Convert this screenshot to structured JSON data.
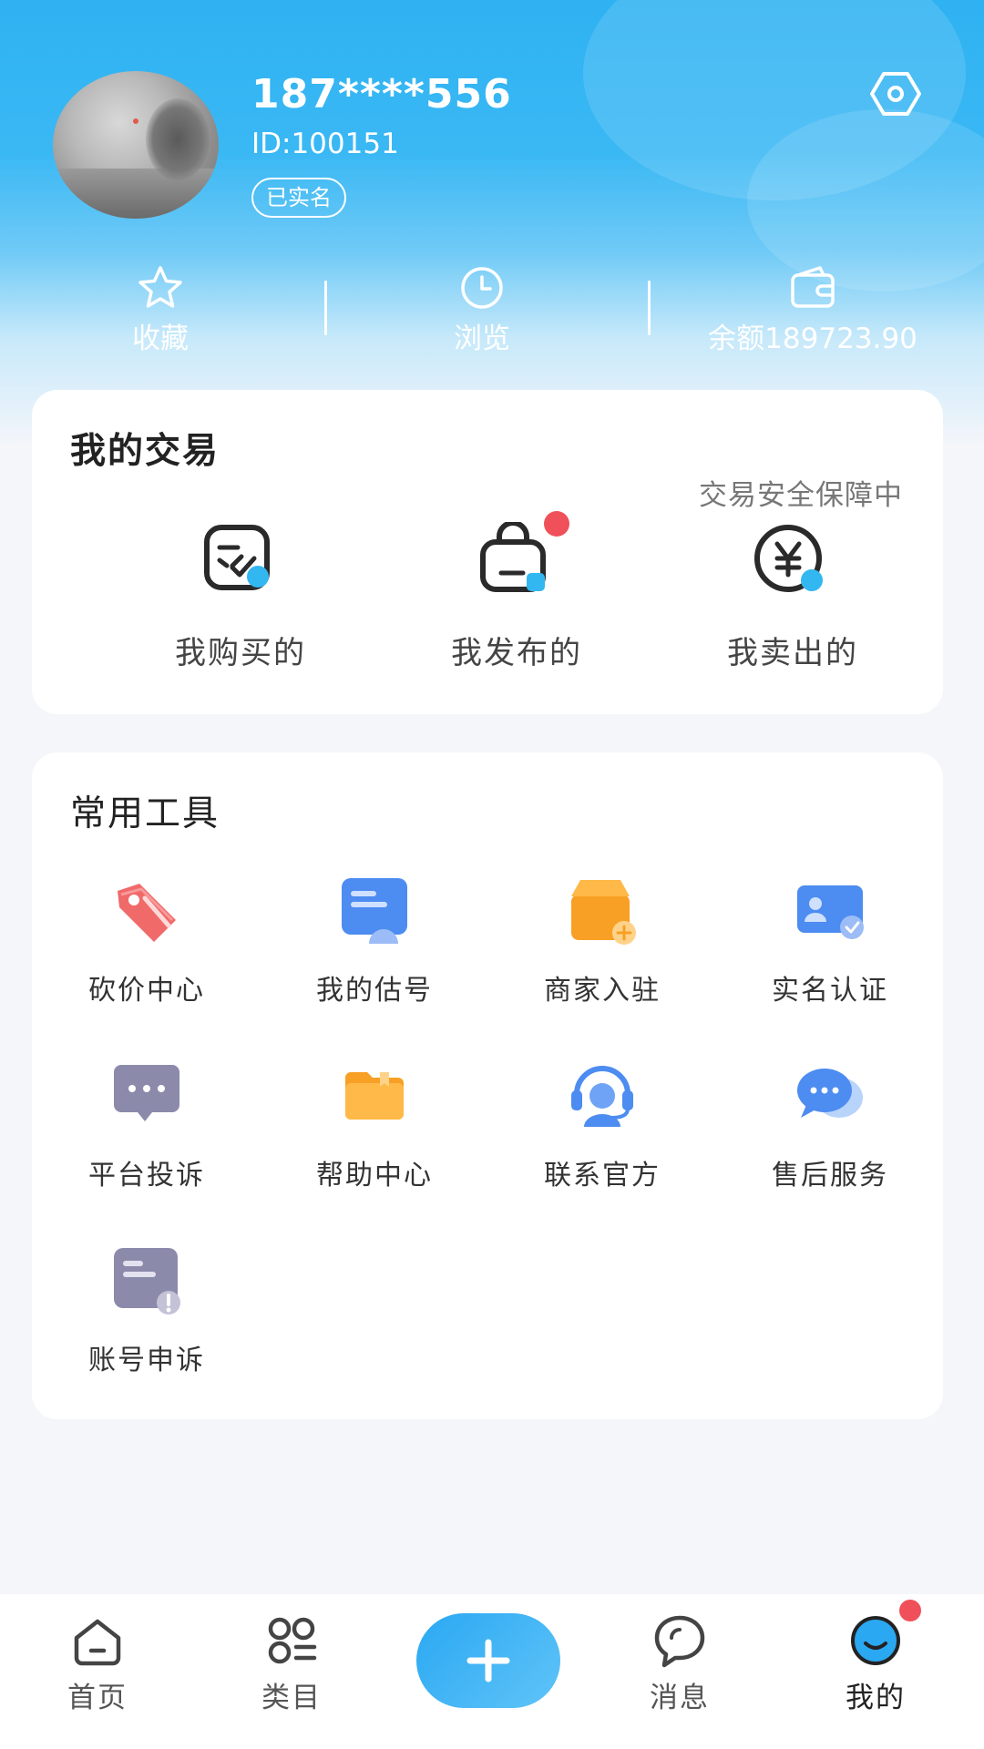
{
  "profile": {
    "phone": "187****556",
    "id_text": "ID:100151",
    "verified_badge": "已实名"
  },
  "stats": {
    "favorites": "收藏",
    "history": "浏览",
    "balance": "余额189723.90"
  },
  "trade": {
    "title": "我的交易",
    "subtitle": "交易安全保障中",
    "items": [
      {
        "label": "我购买的",
        "icon": "purchase-icon"
      },
      {
        "label": "我发布的",
        "icon": "bag-icon"
      },
      {
        "label": "我卖出的",
        "icon": "yen-icon"
      }
    ]
  },
  "tools": {
    "title": "常用工具",
    "items": [
      {
        "label": "砍价中心",
        "icon": "price-tag-icon"
      },
      {
        "label": "我的估号",
        "icon": "valuation-icon"
      },
      {
        "label": "商家入驻",
        "icon": "shop-icon"
      },
      {
        "label": "实名认证",
        "icon": "id-card-icon"
      },
      {
        "label": "平台投诉",
        "icon": "complaint-icon"
      },
      {
        "label": "帮助中心",
        "icon": "folder-icon"
      },
      {
        "label": "联系官方",
        "icon": "headset-icon"
      },
      {
        "label": "售后服务",
        "icon": "chat-bubbles-icon"
      },
      {
        "label": "账号申诉",
        "icon": "appeal-icon"
      }
    ]
  },
  "tabbar": {
    "home": "首页",
    "category": "类目",
    "messages": "消息",
    "mine": "我的"
  },
  "colors": {
    "brand": "#2fb2f2",
    "notification_dot": "#f0505a"
  }
}
